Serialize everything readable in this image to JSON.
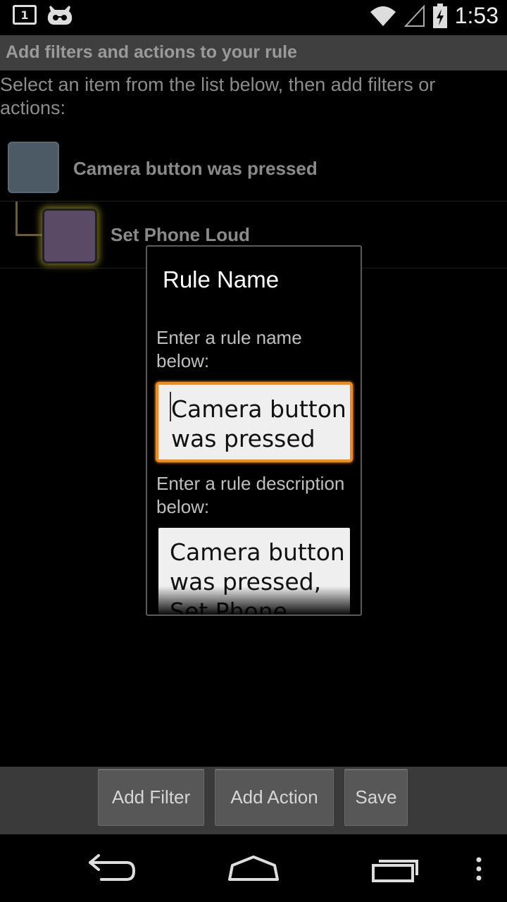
{
  "status_bar": {
    "notification_count": "1",
    "time": "1:53",
    "icons": [
      "calendar-notification-icon",
      "cyanogenmod-icon",
      "wifi-icon",
      "signal-icon",
      "battery-charging-icon"
    ]
  },
  "action_bar": {
    "title": "Add filters and actions to your rule"
  },
  "instructions": "Select an item from the list below, then add filters or actions:",
  "tree": {
    "items": [
      {
        "label": "Camera button was pressed",
        "type": "filter",
        "color": "#4c5a66"
      },
      {
        "label": "Set Phone Loud",
        "type": "action",
        "color": "#5a4a66"
      }
    ]
  },
  "dialog": {
    "title": "Rule Name",
    "name_label": "Enter a rule name below:",
    "name_value": "Camera button was pressed",
    "description_label": "Enter a rule description below:",
    "description_value": "Camera button was pressed, Set Phone Loud"
  },
  "buttons": {
    "add_filter": "Add Filter",
    "add_action": "Add Action",
    "save": "Save"
  },
  "nav_bar": {
    "icons": [
      "back-icon",
      "home-icon",
      "recent-apps-icon",
      "overflow-menu-icon"
    ]
  },
  "colors": {
    "accent_focus": "#f08c1e",
    "action_bar_bg": "#3f3f3f",
    "button_bar_bg": "#3a3a3a"
  }
}
